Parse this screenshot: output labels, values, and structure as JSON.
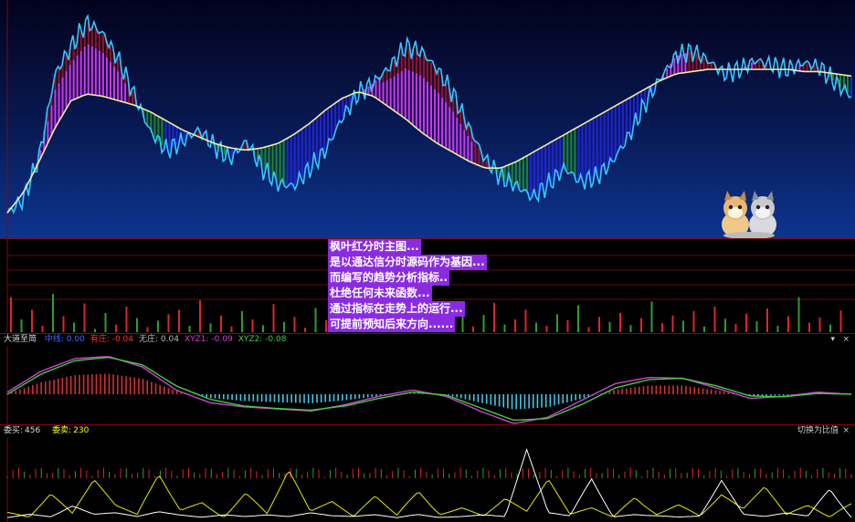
{
  "colors": {
    "price_line": "#33c7ff",
    "ma_line": "#f2eca0",
    "magenta_band": "#d534e8",
    "green_band": "#1e8a1e",
    "red_band": "#a0101e",
    "blue_band": "#2222dd",
    "vol_up": "#e0242c",
    "vol_down": "#2ca02c",
    "ind_red": "#d63030",
    "ind_cyan": "#3fc7e6",
    "ind_line1": "#cc44cc",
    "ind_line2": "#44cc44",
    "ord_yellow": "#e8e800",
    "ord_white": "#ffffff",
    "note_bg": "#8a2be2"
  },
  "notes": [
    "枫叶红分时主图...",
    "是以通达信分时源码作为基因...",
    "而编写的趋势分析指标..",
    "杜绝任何未来函数...",
    "通过指标在走势上的运行...",
    "可提前预知后来方向......"
  ],
  "indicator_pane": {
    "name": "大道至简",
    "items": [
      {
        "label": "中线: 0.00",
        "color": "#4466ff"
      },
      {
        "label": "有庄: -0.04",
        "color": "#ff3333"
      },
      {
        "label": "无庄: 0.04",
        "color": "#bbbbbb"
      },
      {
        "label": "XYZ1: -0.09",
        "color": "#cc44cc"
      },
      {
        "label": "XYZ2: -0.08",
        "color": "#44cc44"
      }
    ]
  },
  "order_pane": {
    "bid_label": "委买:",
    "bid_value": "456",
    "ask_label": "委卖:",
    "ask_value": "230",
    "switch_button": "切换为比值"
  },
  "chart_data": [
    {
      "type": "line",
      "panel": "main",
      "series": [
        {
          "role": "price",
          "values": [
            0.1,
            0.16,
            0.35,
            0.72,
            0.84,
            0.95,
            0.9,
            0.78,
            0.62,
            0.46,
            0.38,
            0.42,
            0.47,
            0.4,
            0.34,
            0.42,
            0.3,
            0.23,
            0.22,
            0.3,
            0.38,
            0.52,
            0.63,
            0.68,
            0.75,
            0.84,
            0.82,
            0.74,
            0.63,
            0.48,
            0.34,
            0.26,
            0.22,
            0.17,
            0.23,
            0.3,
            0.24,
            0.26,
            0.33,
            0.44,
            0.58,
            0.7,
            0.8,
            0.82,
            0.78,
            0.72,
            0.74,
            0.78,
            0.76,
            0.74,
            0.77,
            0.75,
            0.68,
            0.62
          ]
        },
        {
          "role": "moving-average",
          "values": [
            0.1,
            0.19,
            0.33,
            0.48,
            0.6,
            0.63,
            0.62,
            0.6,
            0.58,
            0.55,
            0.51,
            0.47,
            0.44,
            0.41,
            0.39,
            0.38,
            0.39,
            0.41,
            0.45,
            0.5,
            0.56,
            0.61,
            0.64,
            0.62,
            0.57,
            0.52,
            0.46,
            0.41,
            0.37,
            0.33,
            0.3,
            0.3,
            0.33,
            0.37,
            0.41,
            0.45,
            0.49,
            0.53,
            0.57,
            0.61,
            0.65,
            0.69,
            0.72,
            0.73,
            0.74,
            0.74,
            0.74,
            0.74,
            0.74,
            0.74,
            0.73,
            0.73,
            0.72,
            0.71
          ]
        }
      ]
    },
    {
      "type": "bar",
      "panel": "volume",
      "values": [
        0.55,
        0.2,
        0.35,
        0.1,
        0.6,
        0.25,
        0.15,
        0.45,
        0.05,
        0.3,
        0.12,
        0.4,
        0.22,
        0.08,
        0.18,
        0.28,
        0.35,
        0.1,
        0.5,
        0.14,
        0.26,
        0.09,
        0.33,
        0.2,
        0.11,
        0.44,
        0.16,
        0.24,
        0.07,
        0.38,
        0.19,
        0.12,
        0.3,
        0.08,
        0.21,
        0.15,
        0.34,
        0.1,
        0.25,
        0.4,
        0.13,
        0.22,
        0.18,
        0.31,
        0.09,
        0.27,
        0.46,
        0.12,
        0.2,
        0.35,
        0.15,
        0.1,
        0.28,
        0.19,
        0.42,
        0.08,
        0.24,
        0.16,
        0.3,
        0.11,
        0.22,
        0.48,
        0.14,
        0.26,
        0.18,
        0.33,
        0.09,
        0.4,
        0.21,
        0.13,
        0.29,
        0.17,
        0.37,
        0.1,
        0.25,
        0.55,
        0.15,
        0.23,
        0.12,
        0.34
      ],
      "up": [
        1,
        0,
        1,
        1,
        0,
        1,
        0,
        1,
        0,
        0,
        1,
        1,
        0,
        1,
        0,
        1,
        1,
        0,
        1,
        0,
        1,
        1,
        0,
        1,
        0,
        1,
        0,
        1,
        1,
        0,
        1,
        0,
        1,
        0,
        1,
        1,
        0,
        1,
        0,
        1,
        0,
        1,
        1,
        0,
        1,
        0,
        1,
        0,
        1,
        1,
        0,
        1,
        0,
        1,
        0,
        1,
        1,
        0,
        1,
        0,
        1,
        0,
        1,
        1,
        0,
        1,
        0,
        1,
        0,
        1,
        1,
        0,
        1,
        0,
        1,
        0,
        1,
        1,
        0,
        1
      ]
    },
    {
      "type": "line",
      "panel": "indicator",
      "series": [
        {
          "name": "XYZ1",
          "values": [
            0.05,
            0.55,
            0.85,
            0.9,
            0.65,
            0.1,
            -0.2,
            -0.3,
            -0.35,
            -0.4,
            -0.25,
            -0.05,
            0.1,
            -0.05,
            -0.4,
            -0.7,
            -0.55,
            -0.15,
            0.25,
            0.4,
            0.38,
            0.15,
            -0.1,
            -0.05,
            0.05,
            0.0
          ]
        },
        {
          "name": "XYZ2",
          "values": [
            0.0,
            0.48,
            0.8,
            0.88,
            0.7,
            0.2,
            -0.12,
            -0.28,
            -0.34,
            -0.38,
            -0.28,
            -0.1,
            0.05,
            -0.02,
            -0.32,
            -0.62,
            -0.58,
            -0.25,
            0.15,
            0.35,
            0.38,
            0.2,
            -0.04,
            -0.06,
            0.02,
            0.0
          ]
        }
      ]
    },
    {
      "type": "line",
      "panel": "order",
      "series": [
        {
          "name": "委卖",
          "values": [
            0.15,
            0.05,
            0.4,
            0.1,
            0.55,
            0.2,
            0.08,
            0.65,
            0.15,
            0.3,
            0.05,
            0.45,
            0.1,
            0.7,
            0.12,
            0.25,
            0.05,
            0.35,
            0.08,
            0.5,
            0.1,
            0.2,
            0.06,
            0.3,
            0.12,
            0.55,
            0.08,
            0.18,
            0.05,
            0.4,
            0.1,
            0.25,
            0.06,
            0.35,
            0.15,
            0.45,
            0.08,
            0.22,
            0.05,
            0.3
          ]
        },
        {
          "name": "委买",
          "values": [
            0.05,
            0.1,
            0.05,
            0.2,
            0.08,
            0.1,
            0.05,
            0.12,
            0.08,
            0.05,
            0.1,
            0.06,
            0.08,
            0.05,
            0.1,
            0.06,
            0.05,
            0.08,
            0.04,
            0.1,
            0.05,
            0.06,
            0.08,
            0.05,
            0.95,
            0.1,
            0.06,
            0.6,
            0.05,
            0.1,
            0.08,
            0.05,
            0.06,
            0.55,
            0.08,
            0.05,
            0.1,
            0.06,
            0.5,
            0.05
          ]
        }
      ]
    }
  ]
}
